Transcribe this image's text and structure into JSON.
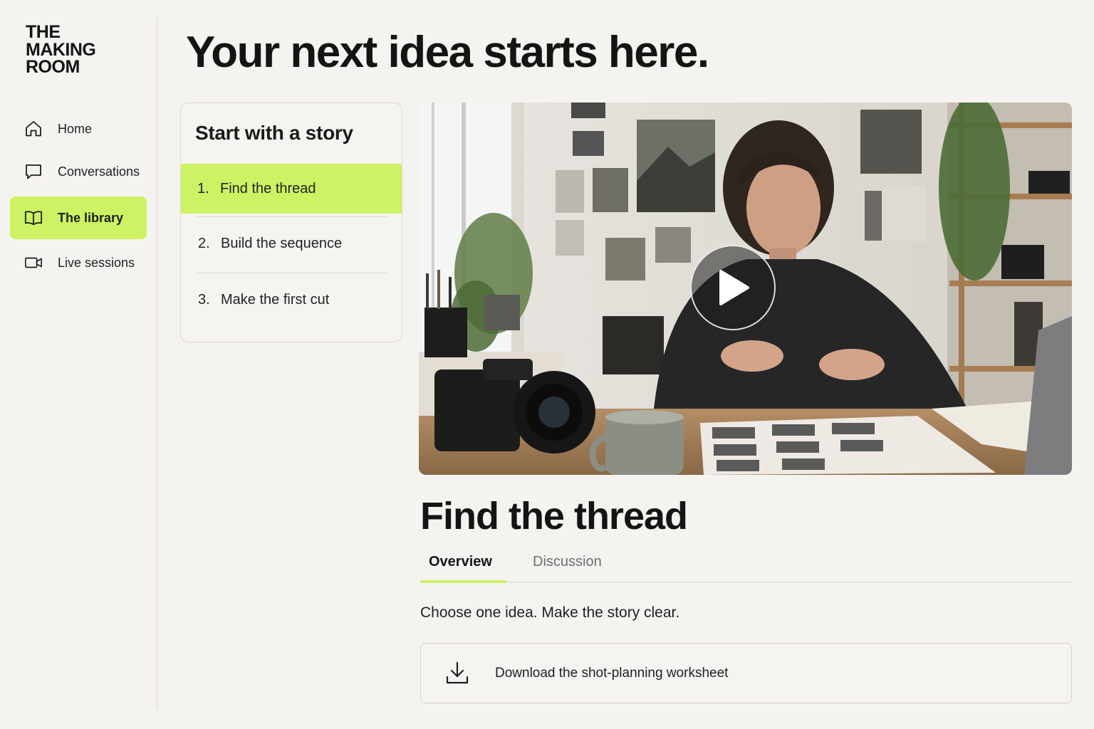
{
  "app": {
    "logo_lines": [
      "THE",
      "MAKING",
      "ROOM"
    ]
  },
  "sidebar": {
    "items": [
      {
        "label": "Home",
        "icon": "home-icon",
        "active": false
      },
      {
        "label": "Conversations",
        "icon": "chat-bubble-icon",
        "active": false
      },
      {
        "label": "The library",
        "icon": "open-book-icon",
        "active": true
      },
      {
        "label": "Live sessions",
        "icon": "video-camera-icon",
        "active": false
      }
    ]
  },
  "main": {
    "title": "Your next idea starts here."
  },
  "lessons": {
    "title": "Start with a story",
    "items": [
      {
        "num": "1.",
        "label": "Find the thread",
        "active": true
      },
      {
        "num": "2.",
        "label": "Build the sequence",
        "active": false
      },
      {
        "num": "3.",
        "label": "Make the first cut",
        "active": false
      }
    ]
  },
  "video": {
    "play_icon": "play-icon"
  },
  "lesson_detail": {
    "heading": "Find the thread",
    "tabs": [
      {
        "label": "Overview",
        "active": true
      },
      {
        "label": "Discussion",
        "active": false
      }
    ],
    "overview_text": "Choose one idea. Make the story clear.",
    "download_label": "Download the shot-planning worksheet",
    "download_icon": "download-icon"
  },
  "colors": {
    "accent": "#cdf263",
    "background": "#f5f3ef",
    "text": "#141414"
  }
}
